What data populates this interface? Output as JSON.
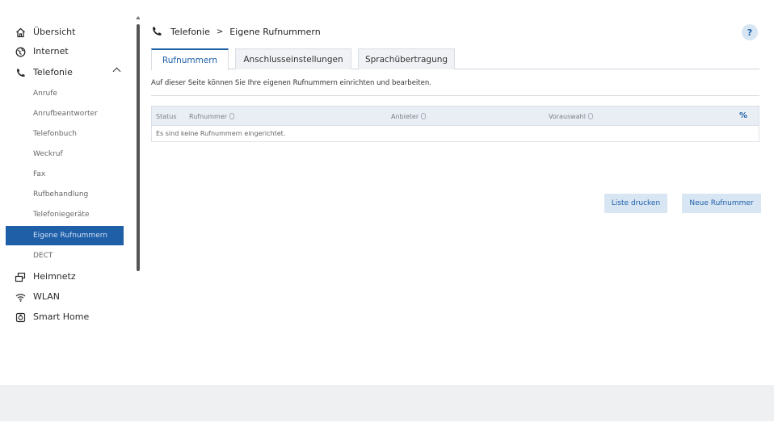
{
  "sidebar": {
    "main_items": [
      {
        "label": "Übersicht",
        "icon": "home-icon"
      },
      {
        "label": "Internet",
        "icon": "globe-icon"
      },
      {
        "label": "Telefonie",
        "icon": "phone-icon",
        "expanded": true
      },
      {
        "label": "Heimnetz",
        "icon": "network-icon"
      },
      {
        "label": "WLAN",
        "icon": "wifi-icon"
      },
      {
        "label": "Smart Home",
        "icon": "smart-home-icon"
      }
    ],
    "telefonie_sub": [
      "Anrufe",
      "Anrufbeantworter",
      "Telefonbuch",
      "Weckruf",
      "Fax",
      "Rufbehandlung",
      "Telefoniegeräte",
      "Eigene Rufnummern",
      "DECT"
    ],
    "active_sub": "Eigene Rufnummern"
  },
  "breadcrumb": {
    "section": "Telefonie",
    "separator": ">",
    "page": "Eigene Rufnummern"
  },
  "help": {
    "label": "?"
  },
  "tabs": [
    "Rufnummern",
    "Anschlusseinstellungen",
    "Sprachübertragung"
  ],
  "active_tab": "Rufnummern",
  "intro_text": "Auf dieser Seite können Sie Ihre eigenen Rufnummern einrichten und bearbeiten.",
  "table": {
    "columns": [
      "Status",
      "Rufnummer",
      "Anbieter",
      "Vorauswahl"
    ],
    "settings_icon": "column-settings-icon",
    "settings_label": "%",
    "empty_message": "Es sind keine Rufnummern eingerichtet."
  },
  "actions": {
    "print_label": "Liste drucken",
    "new_label": "Neue Rufnummer"
  },
  "colors": {
    "accent": "#1f5fa8",
    "button_bg": "#d8e6f4",
    "active_nav_bg": "#1f5fa8",
    "page_bg": "#eef0f2"
  }
}
